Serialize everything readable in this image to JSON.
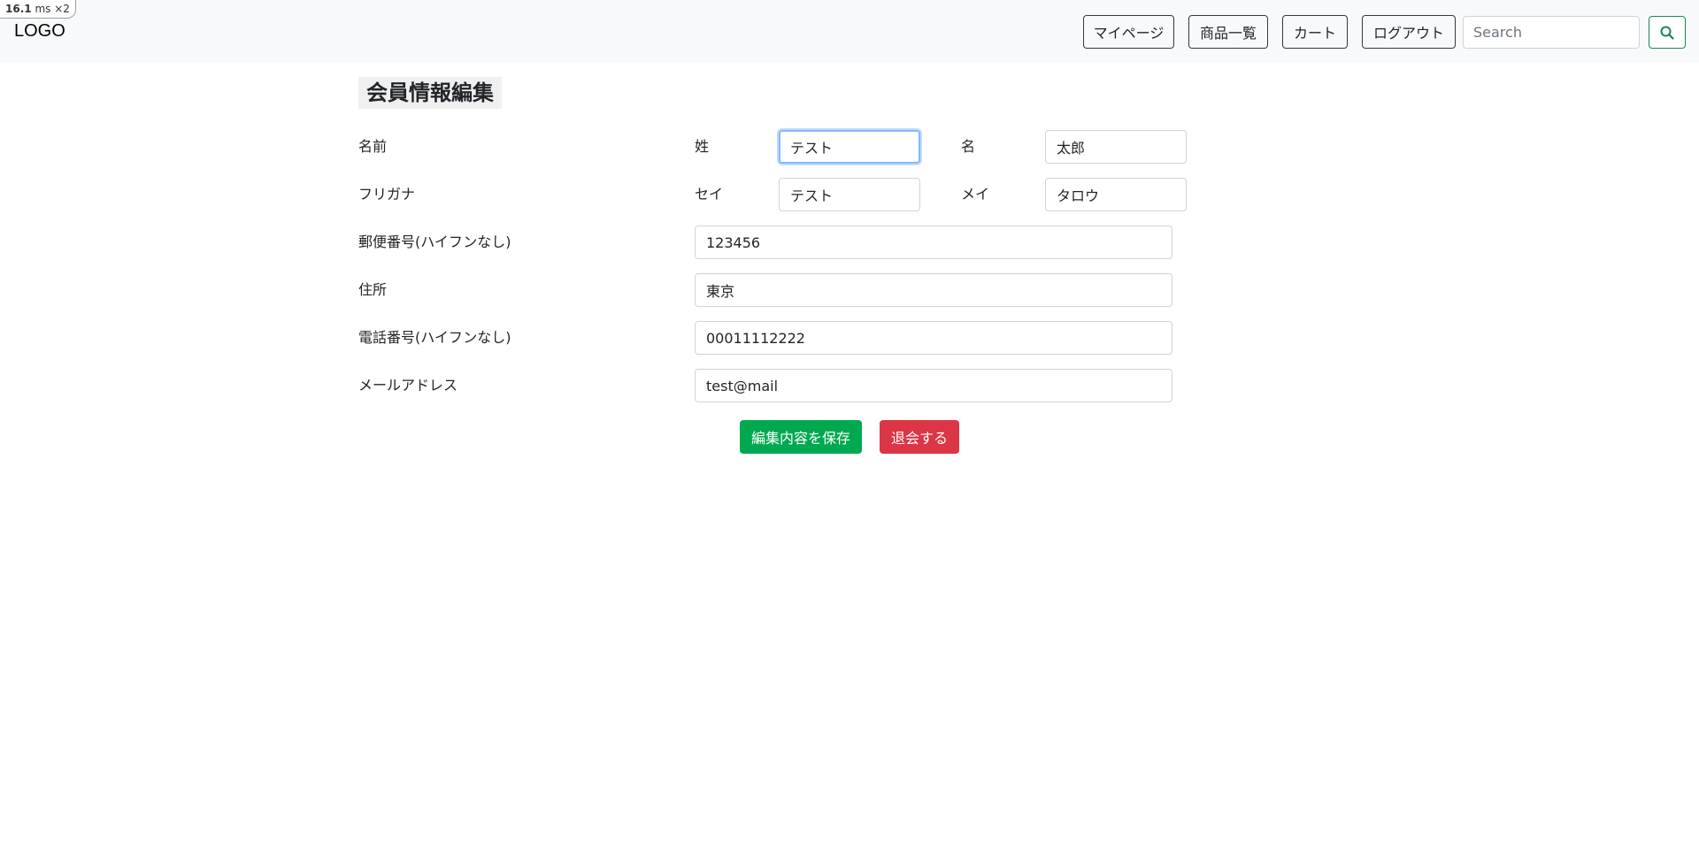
{
  "perf": {
    "value": "16.1",
    "unit": "ms",
    "multiplier": "×2"
  },
  "navbar": {
    "logo": "LOGO",
    "links": [
      "マイページ",
      "商品一覧",
      "カート",
      "ログアウト"
    ],
    "search_placeholder": "Search"
  },
  "page": {
    "title": "会員情報編集"
  },
  "form": {
    "name_label": "名前",
    "last_name_label": "姓",
    "last_name_value": "テスト",
    "first_name_label": "名",
    "first_name_value": "太郎",
    "kana_label": "フリガナ",
    "last_kana_label": "セイ",
    "last_kana_value": "テスト",
    "first_kana_label": "メイ",
    "first_kana_value": "タロウ",
    "postal_label": "郵便番号(ハイフンなし)",
    "postal_value": "123456",
    "address_label": "住所",
    "address_value": "東京",
    "phone_label": "電話番号(ハイフンなし)",
    "phone_value": "00011112222",
    "email_label": "メールアドレス",
    "email_value": "test@mail"
  },
  "actions": {
    "save": "編集内容を保存",
    "withdraw": "退会する"
  },
  "colors": {
    "save": "#00a94f",
    "withdraw": "#dc3545",
    "search_accent": "#198754",
    "focus": "#86b7fe"
  },
  "icons": {
    "search": "search-icon"
  }
}
